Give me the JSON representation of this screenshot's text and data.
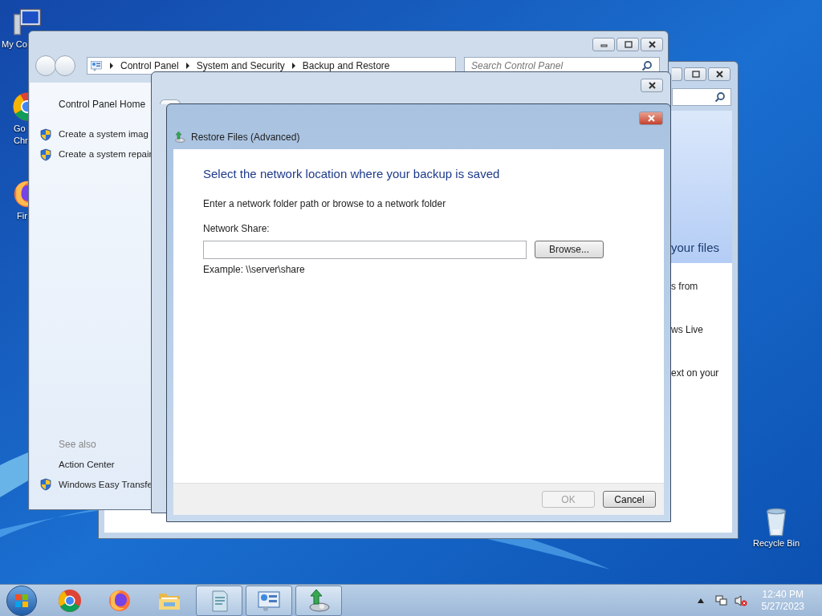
{
  "desktop_icons": [
    {
      "kind": "computer",
      "lines": [
        "My Co"
      ]
    },
    {
      "kind": "chrome",
      "lines": [
        "Go",
        "Chr"
      ]
    },
    {
      "kind": "firefox",
      "lines": [
        "Fir"
      ]
    },
    {
      "kind": "recycle-bin",
      "lines": [
        "Recycle Bin"
      ]
    }
  ],
  "back_window": {
    "heading": "your files",
    "lines": [
      "s from",
      "ws Live",
      "ext on your"
    ]
  },
  "control_panel_window": {
    "breadcrumbs": [
      "Control Panel",
      "System and Security",
      "Backup and Restore"
    ],
    "search": {
      "placeholder": "Search Control Panel"
    },
    "home_link": "Control Panel Home",
    "tasks": [
      {
        "label": "Create a system imag",
        "shield": true
      },
      {
        "label": "Create a system repair",
        "shield": true
      }
    ],
    "see_also_heading": "See also",
    "see_also": [
      {
        "label": "Action Center",
        "shield": false
      },
      {
        "label": "Windows Easy Transfe",
        "shield": true
      }
    ]
  },
  "dialog": {
    "title": "Restore Files (Advanced)",
    "heading": "Select the network location where your backup is saved",
    "instruction": "Enter a network folder path or browse to a network folder",
    "field_label": "Network Share:",
    "browse_button": "Browse...",
    "example": "Example: \\\\server\\share",
    "footer_buttons": [
      {
        "label": "OK",
        "disabled": true
      },
      {
        "label": "Cancel",
        "disabled": false
      }
    ]
  },
  "taskbar": {
    "items": [
      {
        "kind": "chrome",
        "running": false
      },
      {
        "kind": "firefox",
        "running": false
      },
      {
        "kind": "folder",
        "running": false
      },
      {
        "kind": "document",
        "running": true
      },
      {
        "kind": "control-panel",
        "running": true
      },
      {
        "kind": "backup",
        "running": true
      }
    ],
    "time": "12:40 PM",
    "date": "5/27/2023"
  }
}
